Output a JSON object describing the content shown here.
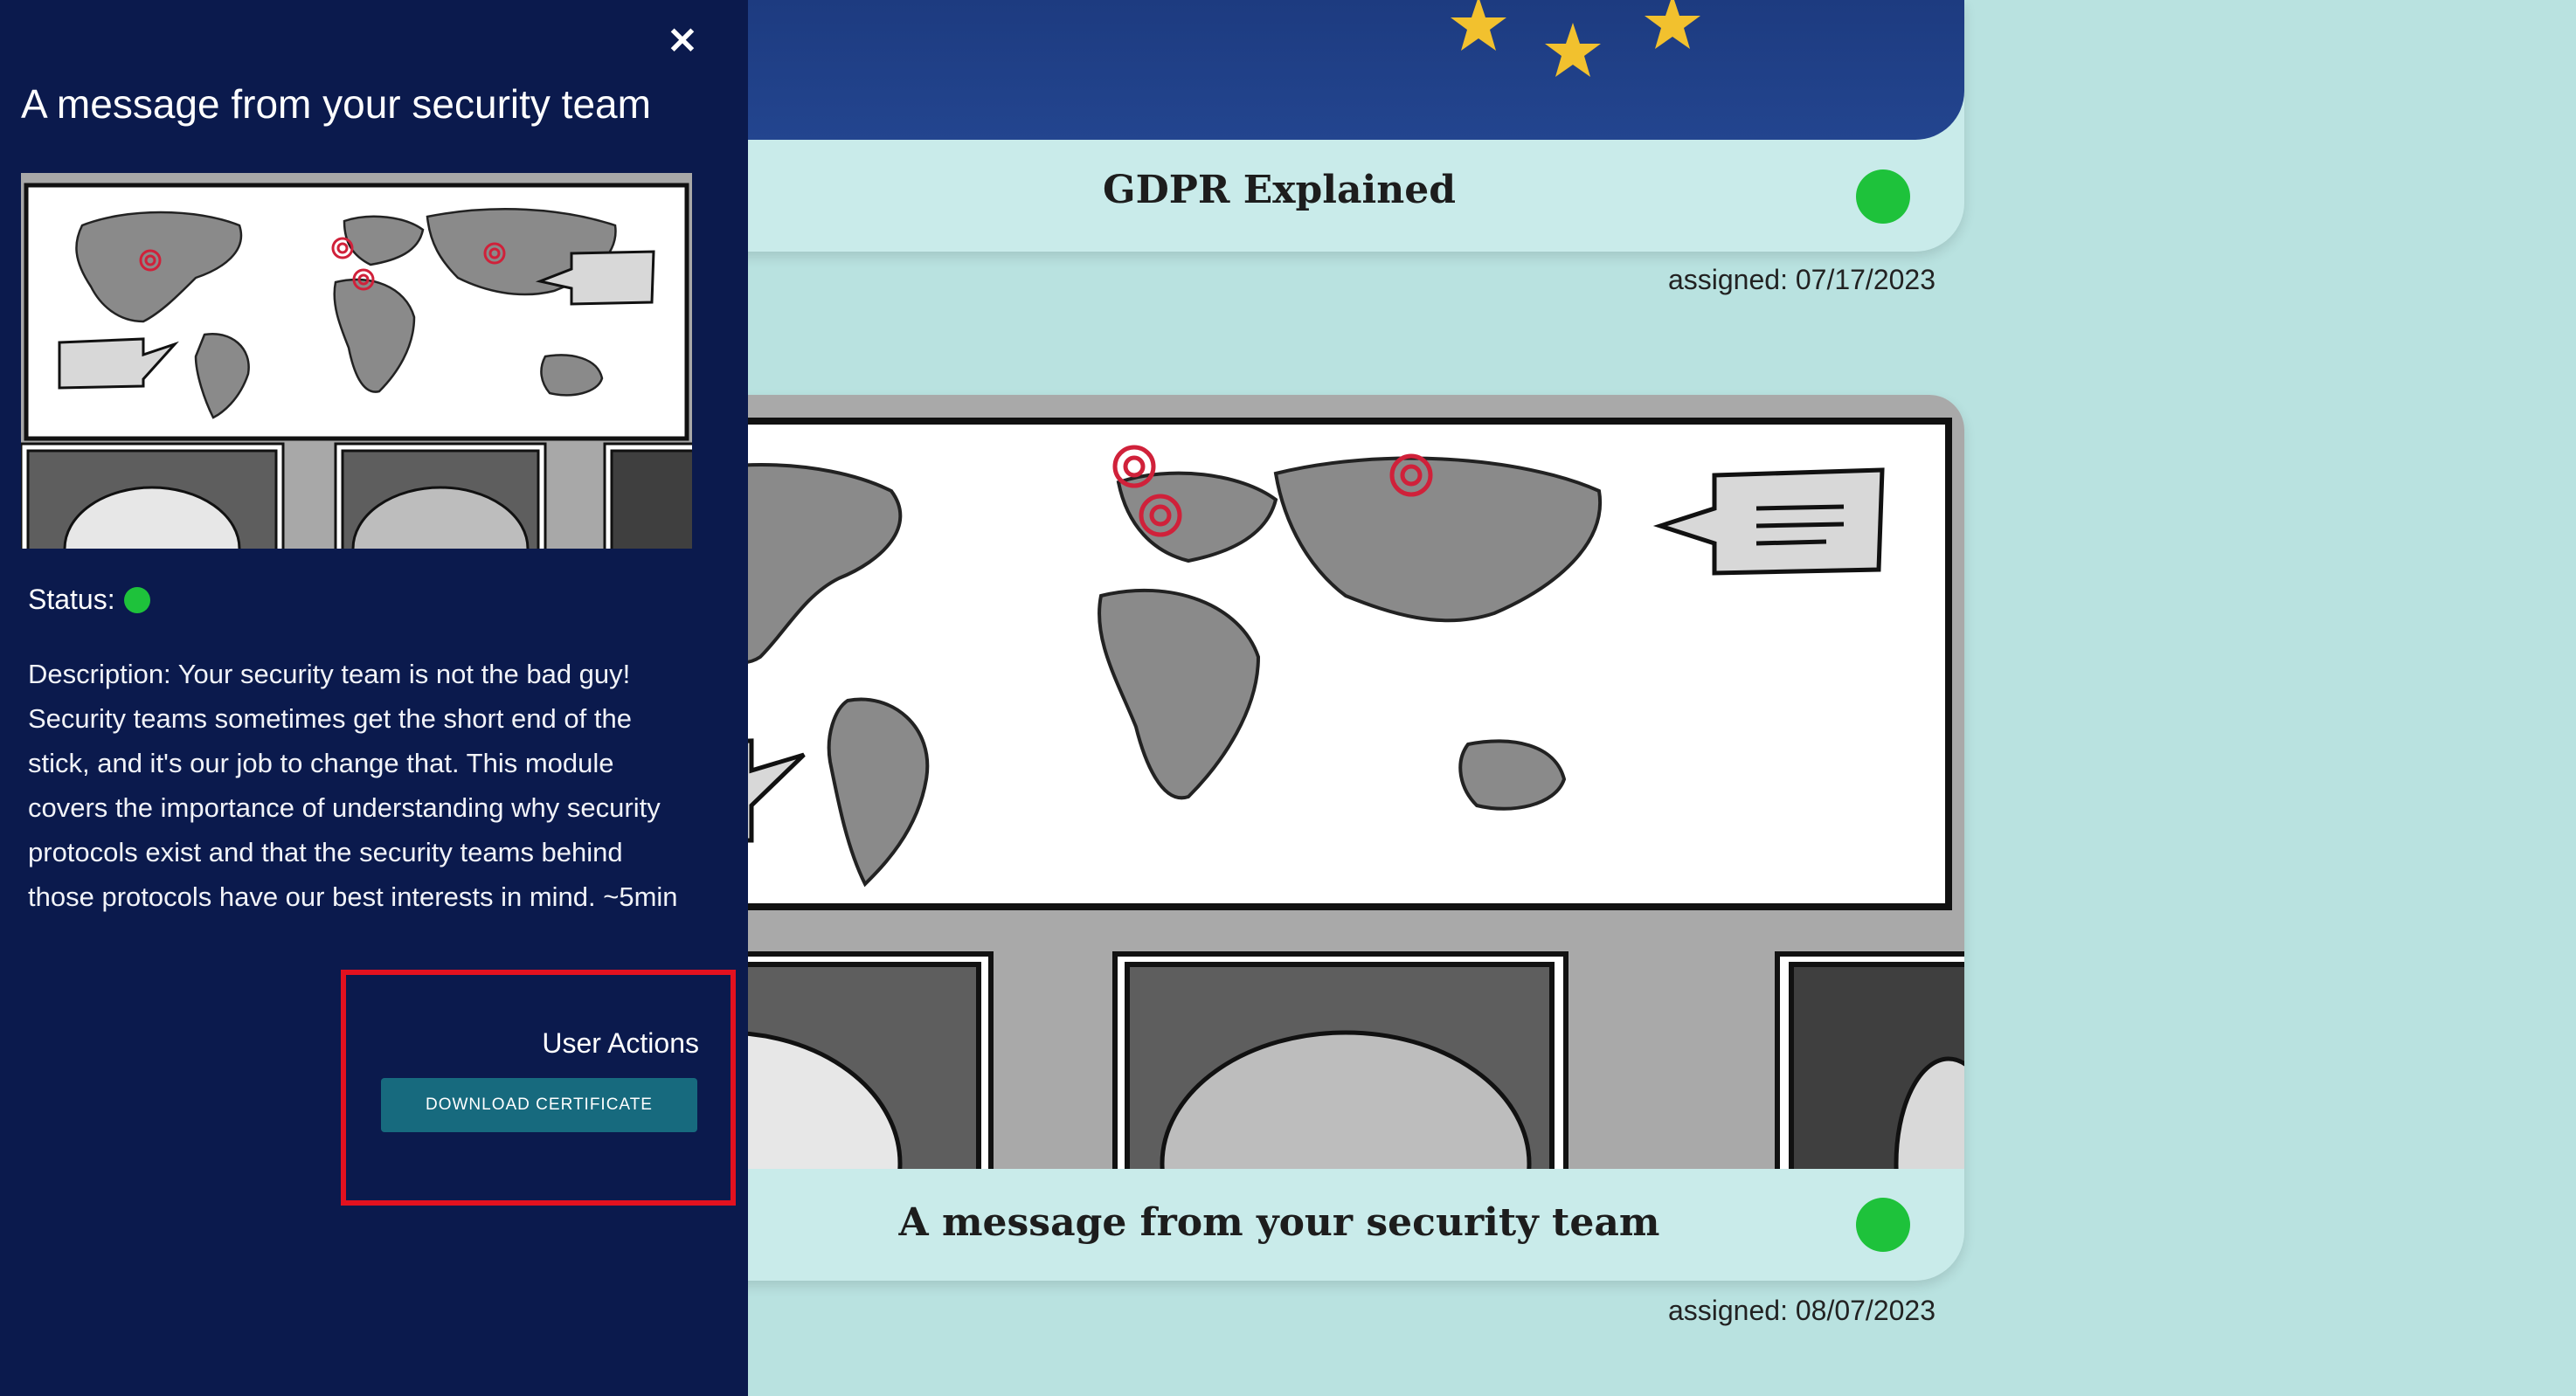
{
  "courses": [
    {
      "title": "GDPR Explained",
      "assigned": "assigned: 07/17/2023",
      "status_color": "#1ec23b"
    },
    {
      "title": "A message from your security team",
      "assigned": "assigned: 08/07/2023",
      "status_color": "#1ec23b"
    }
  ],
  "panel": {
    "close_icon": "close-icon",
    "title": "A message from your security team",
    "status_label": "Status:",
    "description": "Description: Your security team is not the bad guy! Security teams sometimes get the short end of the stick, and it's our job to change that. This module covers the importance of understanding why security protocols exist and that the security teams behind those protocols have our best interests in mind. ~5min",
    "user_actions_label": "User Actions",
    "download_label": "DOWNLOAD CERTIFICATE"
  },
  "colors": {
    "panel_bg": "#0b1a4d",
    "page_bg": "#b9e2e0",
    "card_bg": "#c9ebea",
    "status_green": "#1ec23b",
    "button": "#176a7e",
    "highlight": "#e3111f"
  }
}
